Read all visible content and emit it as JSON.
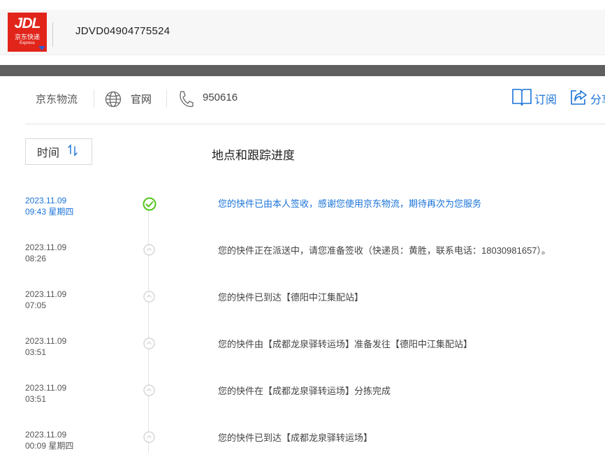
{
  "header": {
    "logo": {
      "main": "JDL",
      "sub": "京东快递",
      "en": "Express"
    },
    "tracking_number": "JDVD04904775524"
  },
  "info": {
    "carrier": "京东物流",
    "website_label": "官网",
    "phone": "950616",
    "subscribe_label": "订阅",
    "share_label": "分享"
  },
  "list_header": {
    "sort_label": "时间",
    "column_title": "地点和跟踪进度"
  },
  "events": [
    {
      "date": "2023.11.09",
      "time": "09:43 星期四",
      "desc": "您的快件已由本人签收，感谢您使用京东物流，期待再次为您服务",
      "status": "delivered"
    },
    {
      "date": "2023.11.09",
      "time": "08:26",
      "desc": "您的快件正在派送中，请您准备签收（快递员：黄胜，联系电话：18030981657）。",
      "status": "transit"
    },
    {
      "date": "2023.11.09",
      "time": "07:05",
      "desc": "您的快件已到达【德阳中江集配站】",
      "status": "transit"
    },
    {
      "date": "2023.11.09",
      "time": "03:51",
      "desc": "您的快件由【成都龙泉驿转运场】准备发往【德阳中江集配站】",
      "status": "transit"
    },
    {
      "date": "2023.11.09",
      "time": "03:51",
      "desc": "您的快件在【成都龙泉驿转运场】分拣完成",
      "status": "transit"
    },
    {
      "date": "2023.11.09",
      "time": "00:09 星期四",
      "desc": "您的快件已到达【成都龙泉驿转运场】",
      "status": "transit"
    }
  ],
  "colors": {
    "brand_red": "#e1251b",
    "link_blue": "#1a73d9",
    "success_green": "#52c41a",
    "node_gray": "#cfcfcf"
  }
}
